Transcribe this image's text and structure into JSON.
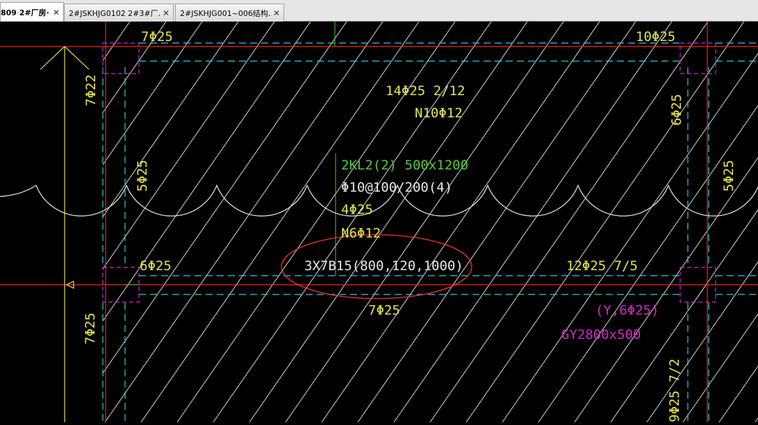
{
  "tabs": [
    {
      "label": "809 2#厂房·",
      "close": "✕",
      "active": true
    },
    {
      "label": "2#JSKHJG0102 2#3#厂…",
      "close": "✕",
      "active": false
    },
    {
      "label": "2#JSKHJG001~006结构…",
      "close": "✕",
      "active": false
    }
  ],
  "drawing": {
    "colors": {
      "background": "#000000",
      "red": "#ff2020",
      "cyan": "#22d3e6",
      "yellow": "#e5e54a",
      "green": "#55c83a",
      "magenta": "#d029c8",
      "white": "#e8e8e8"
    },
    "labels": {
      "top_left_rebar": "7Φ25",
      "top_right_rebar": "10Φ25",
      "left_vertical_top": "7Φ22",
      "right_vertical_top": "6Φ25",
      "mid_top_1": "14Φ25 2/12",
      "mid_top_2": "N10Φ12",
      "left_vertical_mid": "5Φ25",
      "right_vertical_mid": "5Φ25",
      "beam_name": "2KL2(2) 500x1200",
      "beam_stirrup": "Φ10@100/200(4)",
      "beam_top": "4Φ25",
      "beam_side": "N6Φ12",
      "left_bottom_rebar": "6Φ25",
      "circled_label": "3X7B15(800,120,1000)",
      "right_bottom_rebar": "12Φ25 7/5",
      "bottom_center_rebar": "7Φ25",
      "left_vertical_bottom": "7Φ25",
      "magenta_1": "(Y,6Φ25)",
      "magenta_2": "GY2800x500",
      "right_vertical_bottom": "9Φ25 7/2"
    }
  }
}
